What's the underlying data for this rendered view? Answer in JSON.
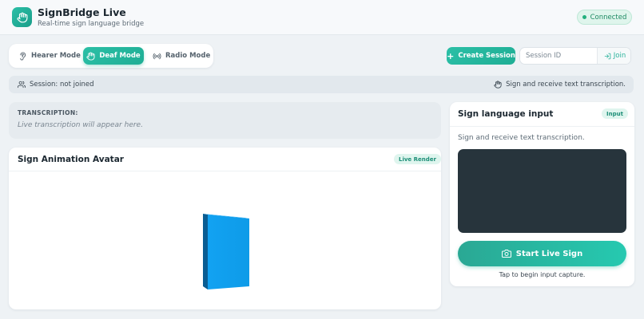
{
  "header": {
    "title": "SignBridge Live",
    "subtitle": "Real-time sign language bridge",
    "status": "Connected",
    "status_color": "#22b07d",
    "logo_icon": "hand-icon"
  },
  "modes": {
    "items": [
      {
        "label": "Hearer Mode",
        "icon": "ear-icon",
        "active": false
      },
      {
        "label": "Deaf Mode",
        "icon": "hand-icon",
        "active": true
      },
      {
        "label": "Radio Mode",
        "icon": "radio-waves-icon",
        "active": false
      }
    ]
  },
  "session": {
    "create_label": "Create Session",
    "input_placeholder": "Session ID",
    "input_value": "",
    "join_label": "Join",
    "status": "Session: not joined",
    "hint": "Sign and receive text transcription."
  },
  "transcription": {
    "label": "TRANSCRIPTION:",
    "placeholder": "Live transcription will appear here."
  },
  "avatar": {
    "title": "Sign Animation Avatar",
    "badge": "Live Render"
  },
  "input": {
    "title": "Sign language input",
    "badge": "Input",
    "description": "Sign and receive text transcription.",
    "start_label": "Start Live Sign",
    "hint": "Tap to begin input capture."
  },
  "colors": {
    "accent": "#2bbfa6",
    "camera_bg": "#27343c",
    "avatar_block": "#1aa3f5"
  }
}
